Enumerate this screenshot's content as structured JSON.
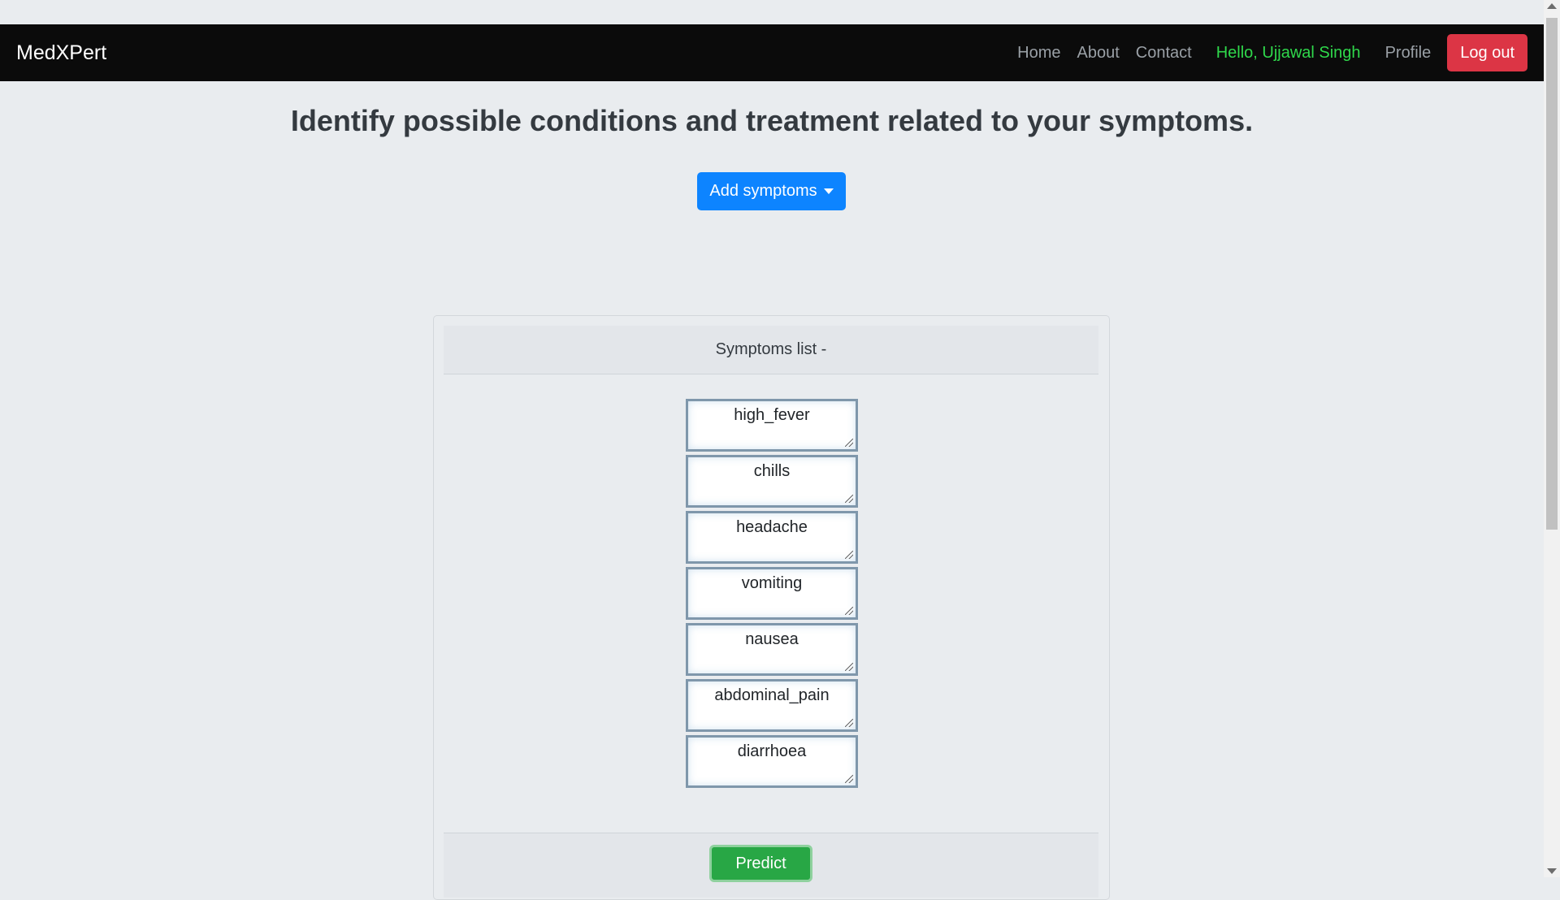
{
  "navbar": {
    "brand": "MedXPert",
    "links": [
      "Home",
      "About",
      "Contact"
    ],
    "greeting": "Hello, Ujjawal Singh",
    "profile": "Profile",
    "logout": "Log out"
  },
  "main": {
    "title": "Identify possible conditions and treatment related to your symptoms.",
    "add_button": "Add symptoms"
  },
  "card": {
    "header": "Symptoms list -",
    "symptoms": [
      "high_fever",
      "chills",
      "headache",
      "vomiting",
      "nausea",
      "abdominal_pain",
      "diarrhoea"
    ],
    "predict": "Predict"
  },
  "colors": {
    "navbar_bg": "#0b0b0b",
    "greeting": "#2fd84b",
    "logout": "#dc3545",
    "primary": "#0d84ff",
    "success": "#28a745"
  }
}
